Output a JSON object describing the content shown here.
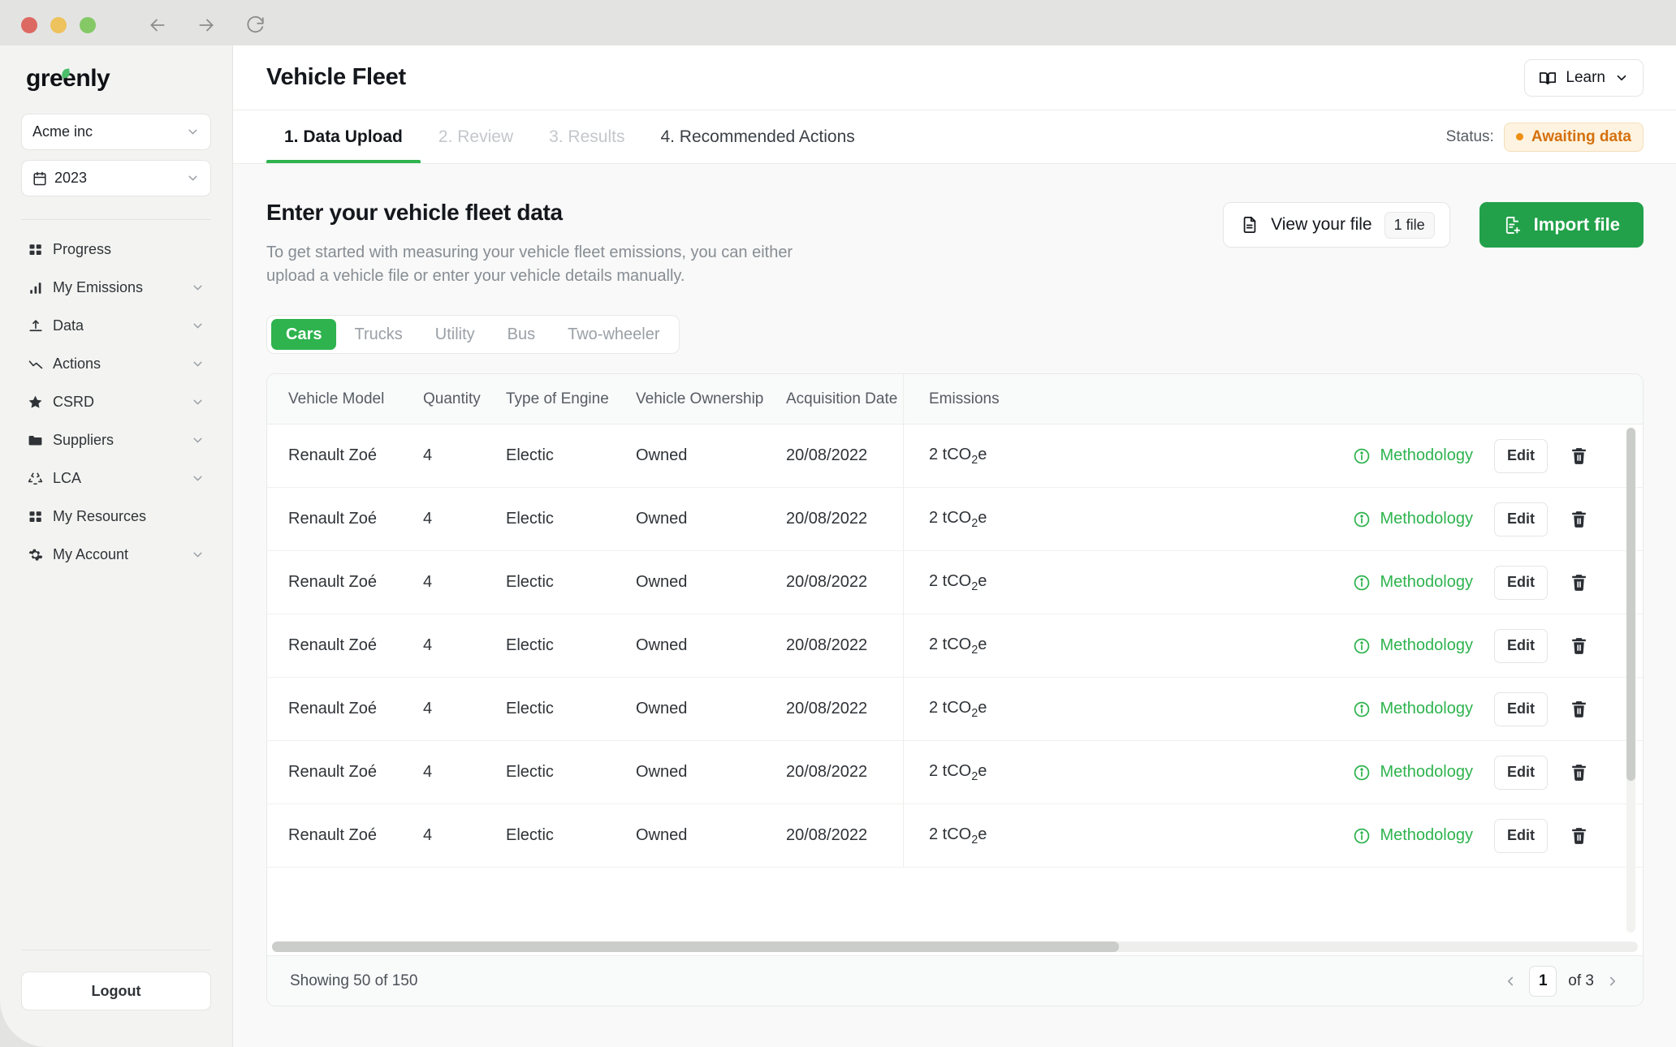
{
  "window": {
    "nav": {
      "back": "back-arrow",
      "forward": "forward-arrow",
      "reload": "reload"
    }
  },
  "sidebar": {
    "logo": "greenly",
    "company_select": {
      "value": "Acme inc"
    },
    "year_select": {
      "value": "2023"
    },
    "items": [
      {
        "label": "Progress",
        "icon": "grid-icon",
        "expandable": false
      },
      {
        "label": "My Emissions",
        "icon": "bar-chart-icon",
        "expandable": true
      },
      {
        "label": "Data",
        "icon": "upload-icon",
        "expandable": true
      },
      {
        "label": "Actions",
        "icon": "trend-down-icon",
        "expandable": true
      },
      {
        "label": "CSRD",
        "icon": "star-icon",
        "expandable": true
      },
      {
        "label": "Suppliers",
        "icon": "folder-icon",
        "expandable": true
      },
      {
        "label": "LCA",
        "icon": "recycle-icon",
        "expandable": true
      },
      {
        "label": "My Resources",
        "icon": "grid-icon",
        "expandable": false
      },
      {
        "label": "My Account",
        "icon": "gear-icon",
        "expandable": true
      }
    ],
    "logout_label": "Logout"
  },
  "header": {
    "title": "Vehicle Fleet",
    "learn_label": "Learn"
  },
  "tabs": [
    {
      "label": "1. Data Upload",
      "state": "active"
    },
    {
      "label": "2. Review",
      "state": "disabled"
    },
    {
      "label": "3. Results",
      "state": "disabled"
    },
    {
      "label": "4. Recommended Actions",
      "state": "dark"
    }
  ],
  "status": {
    "label": "Status:",
    "value": "Awaiting data",
    "color": "#d5700d",
    "background": "#fdf3e0"
  },
  "main": {
    "section_title": "Enter your vehicle fleet data",
    "section_desc": "To get started with measuring your vehicle fleet emissions, you can either upload a vehicle file or enter your vehicle details manually.",
    "view_file_label": "View your file",
    "file_count": "1 file",
    "import_label": "Import file",
    "accent_green": "#22a14a"
  },
  "filters": [
    {
      "label": "Cars",
      "active": true
    },
    {
      "label": "Trucks",
      "active": false
    },
    {
      "label": "Utility",
      "active": false
    },
    {
      "label": "Bus",
      "active": false
    },
    {
      "label": "Two-wheeler",
      "active": false
    }
  ],
  "table": {
    "columns": [
      "Vehicle Model",
      "Quantity",
      "Type of Engine",
      "Vehicle Ownership",
      "Acquisition Date",
      "Emissions"
    ],
    "rows": [
      {
        "model": "Renault Zoé",
        "quantity": "4",
        "engine": "Electic",
        "ownership": "Owned",
        "date": "20/08/2022",
        "emissions_value": "2 tCO",
        "emissions_sub": "2",
        "emissions_suffix": "e"
      },
      {
        "model": "Renault Zoé",
        "quantity": "4",
        "engine": "Electic",
        "ownership": "Owned",
        "date": "20/08/2022",
        "emissions_value": "2 tCO",
        "emissions_sub": "2",
        "emissions_suffix": "e"
      },
      {
        "model": "Renault Zoé",
        "quantity": "4",
        "engine": "Electic",
        "ownership": "Owned",
        "date": "20/08/2022",
        "emissions_value": "2 tCO",
        "emissions_sub": "2",
        "emissions_suffix": "e"
      },
      {
        "model": "Renault Zoé",
        "quantity": "4",
        "engine": "Electic",
        "ownership": "Owned",
        "date": "20/08/2022",
        "emissions_value": "2 tCO",
        "emissions_sub": "2",
        "emissions_suffix": "e"
      },
      {
        "model": "Renault Zoé",
        "quantity": "4",
        "engine": "Electic",
        "ownership": "Owned",
        "date": "20/08/2022",
        "emissions_value": "2 tCO",
        "emissions_sub": "2",
        "emissions_suffix": "e"
      },
      {
        "model": "Renault Zoé",
        "quantity": "4",
        "engine": "Electic",
        "ownership": "Owned",
        "date": "20/08/2022",
        "emissions_value": "2 tCO",
        "emissions_sub": "2",
        "emissions_suffix": "e"
      },
      {
        "model": "Renault Zoé",
        "quantity": "4",
        "engine": "Electic",
        "ownership": "Owned",
        "date": "20/08/2022",
        "emissions_value": "2 tCO",
        "emissions_sub": "2",
        "emissions_suffix": "e"
      }
    ],
    "methodology_label": "Methodology",
    "edit_label": "Edit",
    "delete_icon": "trash-icon"
  },
  "footer": {
    "showing": "Showing 50 of 150",
    "page": "1",
    "of_total": "of 3"
  }
}
